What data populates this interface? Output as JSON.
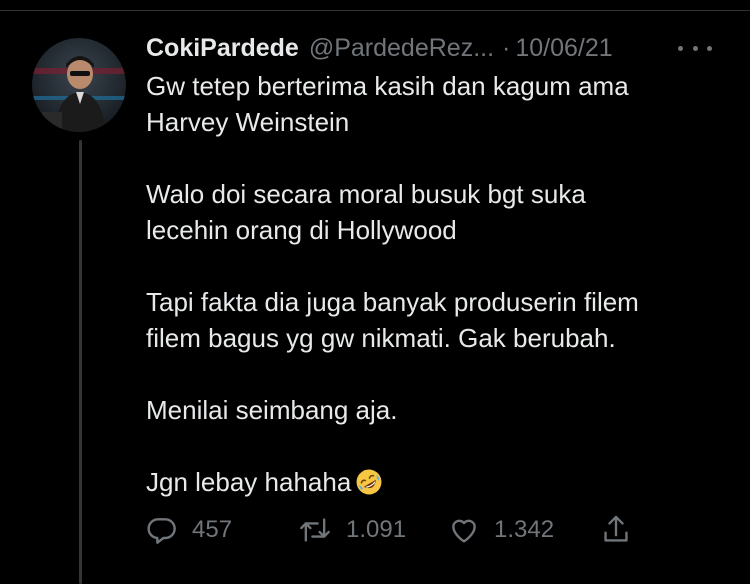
{
  "tweet": {
    "display_name": "CokiPardede",
    "handle": "@PardedeRez...",
    "separator": "·",
    "date": "10/06/21",
    "paragraphs": [
      {
        "lines": [
          "Gw tetep berterima kasih dan kagum ama",
          "Harvey Weinstein"
        ]
      },
      {
        "lines": [
          "Walo doi secara moral busuk bgt suka",
          "lecehin orang di Hollywood"
        ]
      },
      {
        "lines": [
          "Tapi fakta dia juga banyak produserin filem",
          "filem bagus yg gw nikmati. Gak berubah."
        ]
      },
      {
        "lines": [
          "Menilai seimbang aja."
        ]
      },
      {
        "lines": [
          "Jgn lebay hahaha"
        ]
      }
    ],
    "emoji": "rolling-on-floor-laughing",
    "replies": "457",
    "retweets": "1.091",
    "likes": "1.342"
  },
  "icons": {
    "reply": "reply-icon",
    "retweet": "retweet-icon",
    "like": "like-icon",
    "share": "share-icon",
    "more": "more-icon"
  },
  "colors": {
    "background": "#000000",
    "text": "#e7e9ea",
    "secondary": "#71767b",
    "thread_line": "#333639"
  }
}
